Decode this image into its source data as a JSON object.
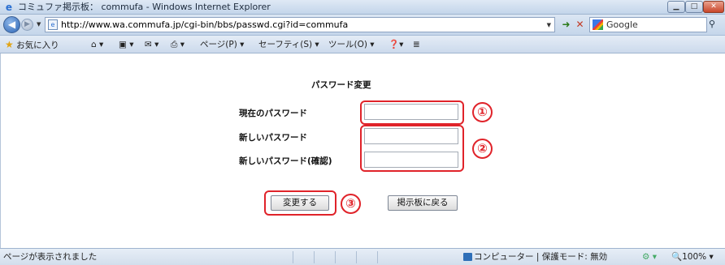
{
  "window": {
    "title": "コミュファ掲示板： commufa - Windows Internet Explorer",
    "min_icon": "minimize-icon",
    "max_icon": "maximize-icon",
    "close_icon": "close-icon"
  },
  "address_bar": {
    "url": "http://www.wa.commufa.jp/cgi-bin/bbs/passwd.cgi?id=commufa",
    "search_placeholder": "Google"
  },
  "command_bar": {
    "favorites": "お気に入り",
    "page_menu": "ページ(P) ▾",
    "safety_menu": "セーフティ(S) ▾",
    "tools_menu": "ツール(O) ▾"
  },
  "form": {
    "title": "パスワード変更",
    "current_password_label": "現在のパスワード",
    "new_password_label": "新しいパスワード",
    "confirm_password_label": "新しいパスワード(確認)",
    "submit_label": "変更する",
    "back_label": "掲示板に戻る"
  },
  "annotations": {
    "marker_1": "①",
    "marker_2": "②",
    "marker_3": "③",
    "color": "#e0232a"
  },
  "status_bar": {
    "status_text": "ページが表示されました",
    "zone_text": "コンピューター | 保護モード: 無効",
    "zoom": "100%"
  }
}
